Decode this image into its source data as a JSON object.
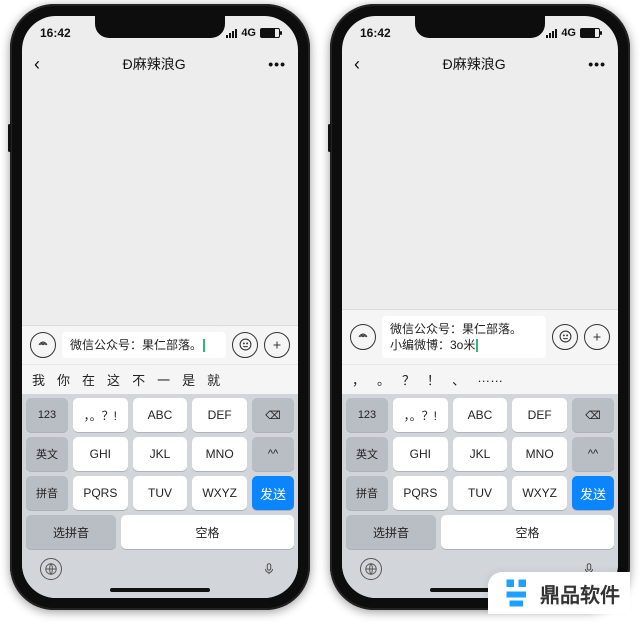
{
  "status": {
    "time": "16:42",
    "net": "4G"
  },
  "nav": {
    "title": "Ð麻辣浪G",
    "more": "•••"
  },
  "compose": {
    "voice_icon": "voice-icon",
    "emoji_icon": "emoji-icon",
    "plus_icon": "plus-icon"
  },
  "phone1": {
    "input_text": "微信公众号：果仁部落。",
    "suggestions": [
      "我",
      "你",
      "在",
      "这",
      "不",
      "一",
      "是",
      "就"
    ]
  },
  "phone2": {
    "input_line1": "微信公众号：果仁部落。",
    "input_line2": "小编微博：3o米",
    "suggestions": [
      "，",
      "。",
      "？",
      "！",
      "、",
      "……"
    ]
  },
  "keyboard": {
    "r1": {
      "k1": "123",
      "k2": "，。？!",
      "k3": "ABC",
      "k4": "DEF",
      "k5": "⌫"
    },
    "r2": {
      "k1": "英文",
      "k2": "GHI",
      "k3": "JKL",
      "k4": "MNO",
      "k5": "^^"
    },
    "r3": {
      "k1": "拼音",
      "k2": "PQRS",
      "k3": "TUV",
      "k4": "WXYZ",
      "k5": "发送"
    },
    "r4": {
      "k1": "选拼音",
      "k2": "空格"
    }
  },
  "branding": {
    "text": "鼎品软件"
  }
}
